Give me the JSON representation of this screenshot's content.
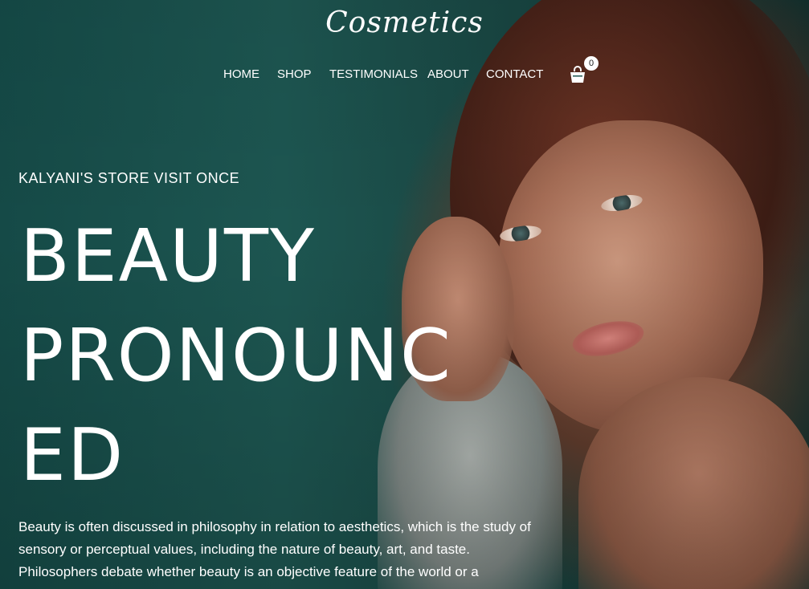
{
  "header": {
    "logo_text": "Cosmetics"
  },
  "nav": {
    "items": [
      "HOME",
      "SHOP",
      "TESTIMONIALS",
      "ABOUT",
      "CONTACT"
    ],
    "cart_icon": "shopping-bag-icon",
    "cart_count": "0"
  },
  "hero": {
    "tagline": "KALYANI'S STORE VISIT ONCE",
    "headline_lines": [
      "BEAUTY",
      "PRONOUNC",
      "ED"
    ],
    "body": "Beauty is often discussed in philosophy in relation to aesthetics, which is the study of sensory or perceptual values, including the nature of beauty, art, and taste. Philosophers debate whether beauty is an objective feature of the world or a subjective"
  },
  "colors": {
    "background_teal": "#1d5651",
    "text": "#ffffff"
  }
}
